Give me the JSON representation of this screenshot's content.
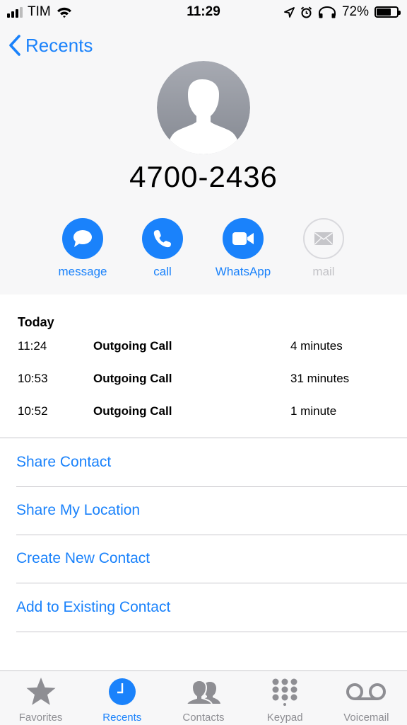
{
  "status_bar": {
    "carrier": "TIM",
    "time": "11:29",
    "battery_percent": "72%",
    "battery_level": 0.72
  },
  "header": {
    "back_label": "Recents",
    "phone_number": "4700-2436"
  },
  "actions": [
    {
      "label": "message",
      "icon": "message-icon",
      "enabled": true
    },
    {
      "label": "call",
      "icon": "phone-icon",
      "enabled": true
    },
    {
      "label": "WhatsApp",
      "icon": "video-icon",
      "enabled": true
    },
    {
      "label": "mail",
      "icon": "mail-icon",
      "enabled": false
    }
  ],
  "history": {
    "title": "Today",
    "calls": [
      {
        "time": "11:24",
        "type": "Outgoing Call",
        "duration": "4 minutes"
      },
      {
        "time": "10:53",
        "type": "Outgoing Call",
        "duration": "31 minutes"
      },
      {
        "time": "10:52",
        "type": "Outgoing Call",
        "duration": "1 minute"
      }
    ]
  },
  "menu": [
    {
      "label": "Share Contact"
    },
    {
      "label": "Share My Location"
    },
    {
      "label": "Create New Contact"
    },
    {
      "label": "Add to Existing Contact"
    }
  ],
  "tabbar": {
    "active": "Recents",
    "tabs": [
      {
        "label": "Favorites",
        "icon": "star-icon"
      },
      {
        "label": "Recents",
        "icon": "clock-icon"
      },
      {
        "label": "Contacts",
        "icon": "contacts-icon"
      },
      {
        "label": "Keypad",
        "icon": "keypad-icon"
      },
      {
        "label": "Voicemail",
        "icon": "voicemail-icon"
      }
    ]
  },
  "colors": {
    "accent": "#1a82fb",
    "background": "#f7f7f8",
    "disabled": "#c3c3c7",
    "inactive_tab": "#8e8e93",
    "separator": "#c8c7cc"
  }
}
